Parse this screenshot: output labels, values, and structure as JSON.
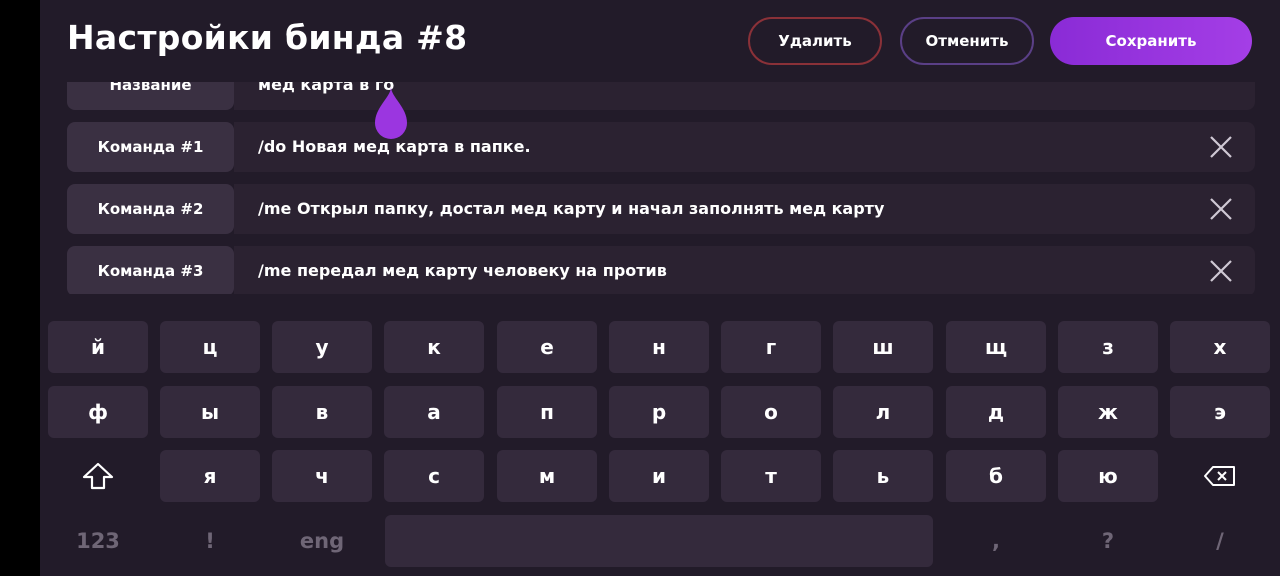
{
  "header": {
    "title": "Настройки бинда #8",
    "delete_label": "Удалить",
    "cancel_label": "Отменить",
    "save_label": "Сохранить"
  },
  "colors": {
    "background": "#221b29",
    "label_bg": "#3a3042",
    "field_bg": "#2b2231",
    "delete_border": "#8a3138",
    "cancel_border": "#5a3f86",
    "accent": "#9b36e0"
  },
  "rows": [
    {
      "label": "Название",
      "value": "мед карта в го"
    },
    {
      "label": "Команда #1",
      "value": "/do Новая мед карта в папке."
    },
    {
      "label": "Команда #2",
      "value": "/me Открыл папку, достал мед карту и  начал заполнять мед карту"
    },
    {
      "label": "Команда #3",
      "value": "/me передал мед карту человеку на против"
    }
  ],
  "keyboard": {
    "row1": [
      "й",
      "ц",
      "у",
      "к",
      "е",
      "н",
      "г",
      "ш",
      "щ",
      "з",
      "х"
    ],
    "row2": [
      "ф",
      "ы",
      "в",
      "а",
      "п",
      "р",
      "о",
      "л",
      "д",
      "ж",
      "э"
    ],
    "row3": [
      "я",
      "ч",
      "с",
      "м",
      "и",
      "т",
      "ь",
      "б",
      "ю"
    ],
    "bottom": {
      "numbers": "123",
      "exclaim": "!",
      "lang": "eng",
      "comma": ",",
      "question": "?",
      "slash": "/"
    },
    "icons": {
      "shift": "shift-icon",
      "backspace": "backspace-icon",
      "close": "close-icon"
    }
  }
}
